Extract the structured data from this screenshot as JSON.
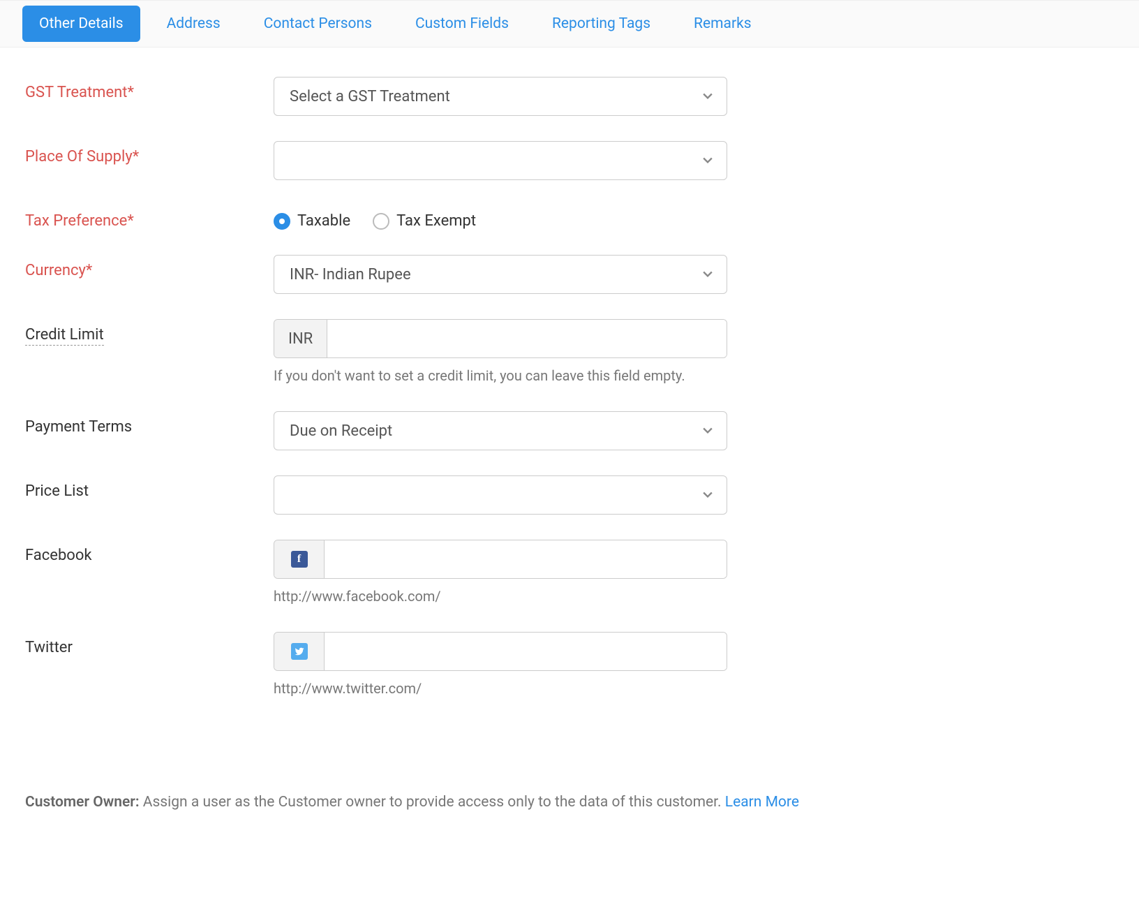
{
  "tabs": {
    "other_details": "Other Details",
    "address": "Address",
    "contact_persons": "Contact Persons",
    "custom_fields": "Custom Fields",
    "reporting_tags": "Reporting Tags",
    "remarks": "Remarks"
  },
  "fields": {
    "gst_treatment": {
      "label": "GST Treatment*",
      "selected_text": "Select a GST Treatment"
    },
    "place_of_supply": {
      "label": "Place Of Supply*",
      "selected_text": ""
    },
    "tax_preference": {
      "label": "Tax Preference*",
      "options": {
        "taxable": "Taxable",
        "tax_exempt": "Tax Exempt"
      },
      "selected": "taxable"
    },
    "currency": {
      "label": "Currency*",
      "selected_text": "INR- Indian Rupee"
    },
    "credit_limit": {
      "label": "Credit Limit",
      "prefix": "INR",
      "value": "",
      "helper": "If you don't want to set a credit limit, you can leave this field empty."
    },
    "payment_terms": {
      "label": "Payment Terms",
      "selected_text": "Due on Receipt"
    },
    "price_list": {
      "label": "Price List",
      "selected_text": ""
    },
    "facebook": {
      "label": "Facebook",
      "value": "",
      "helper": "http://www.facebook.com/"
    },
    "twitter": {
      "label": "Twitter",
      "value": "",
      "helper": "http://www.twitter.com/"
    }
  },
  "owner": {
    "title": "Customer Owner:",
    "text": " Assign a user as the Customer owner to provide access only to the data of this customer. ",
    "learn_more": "Learn More"
  }
}
